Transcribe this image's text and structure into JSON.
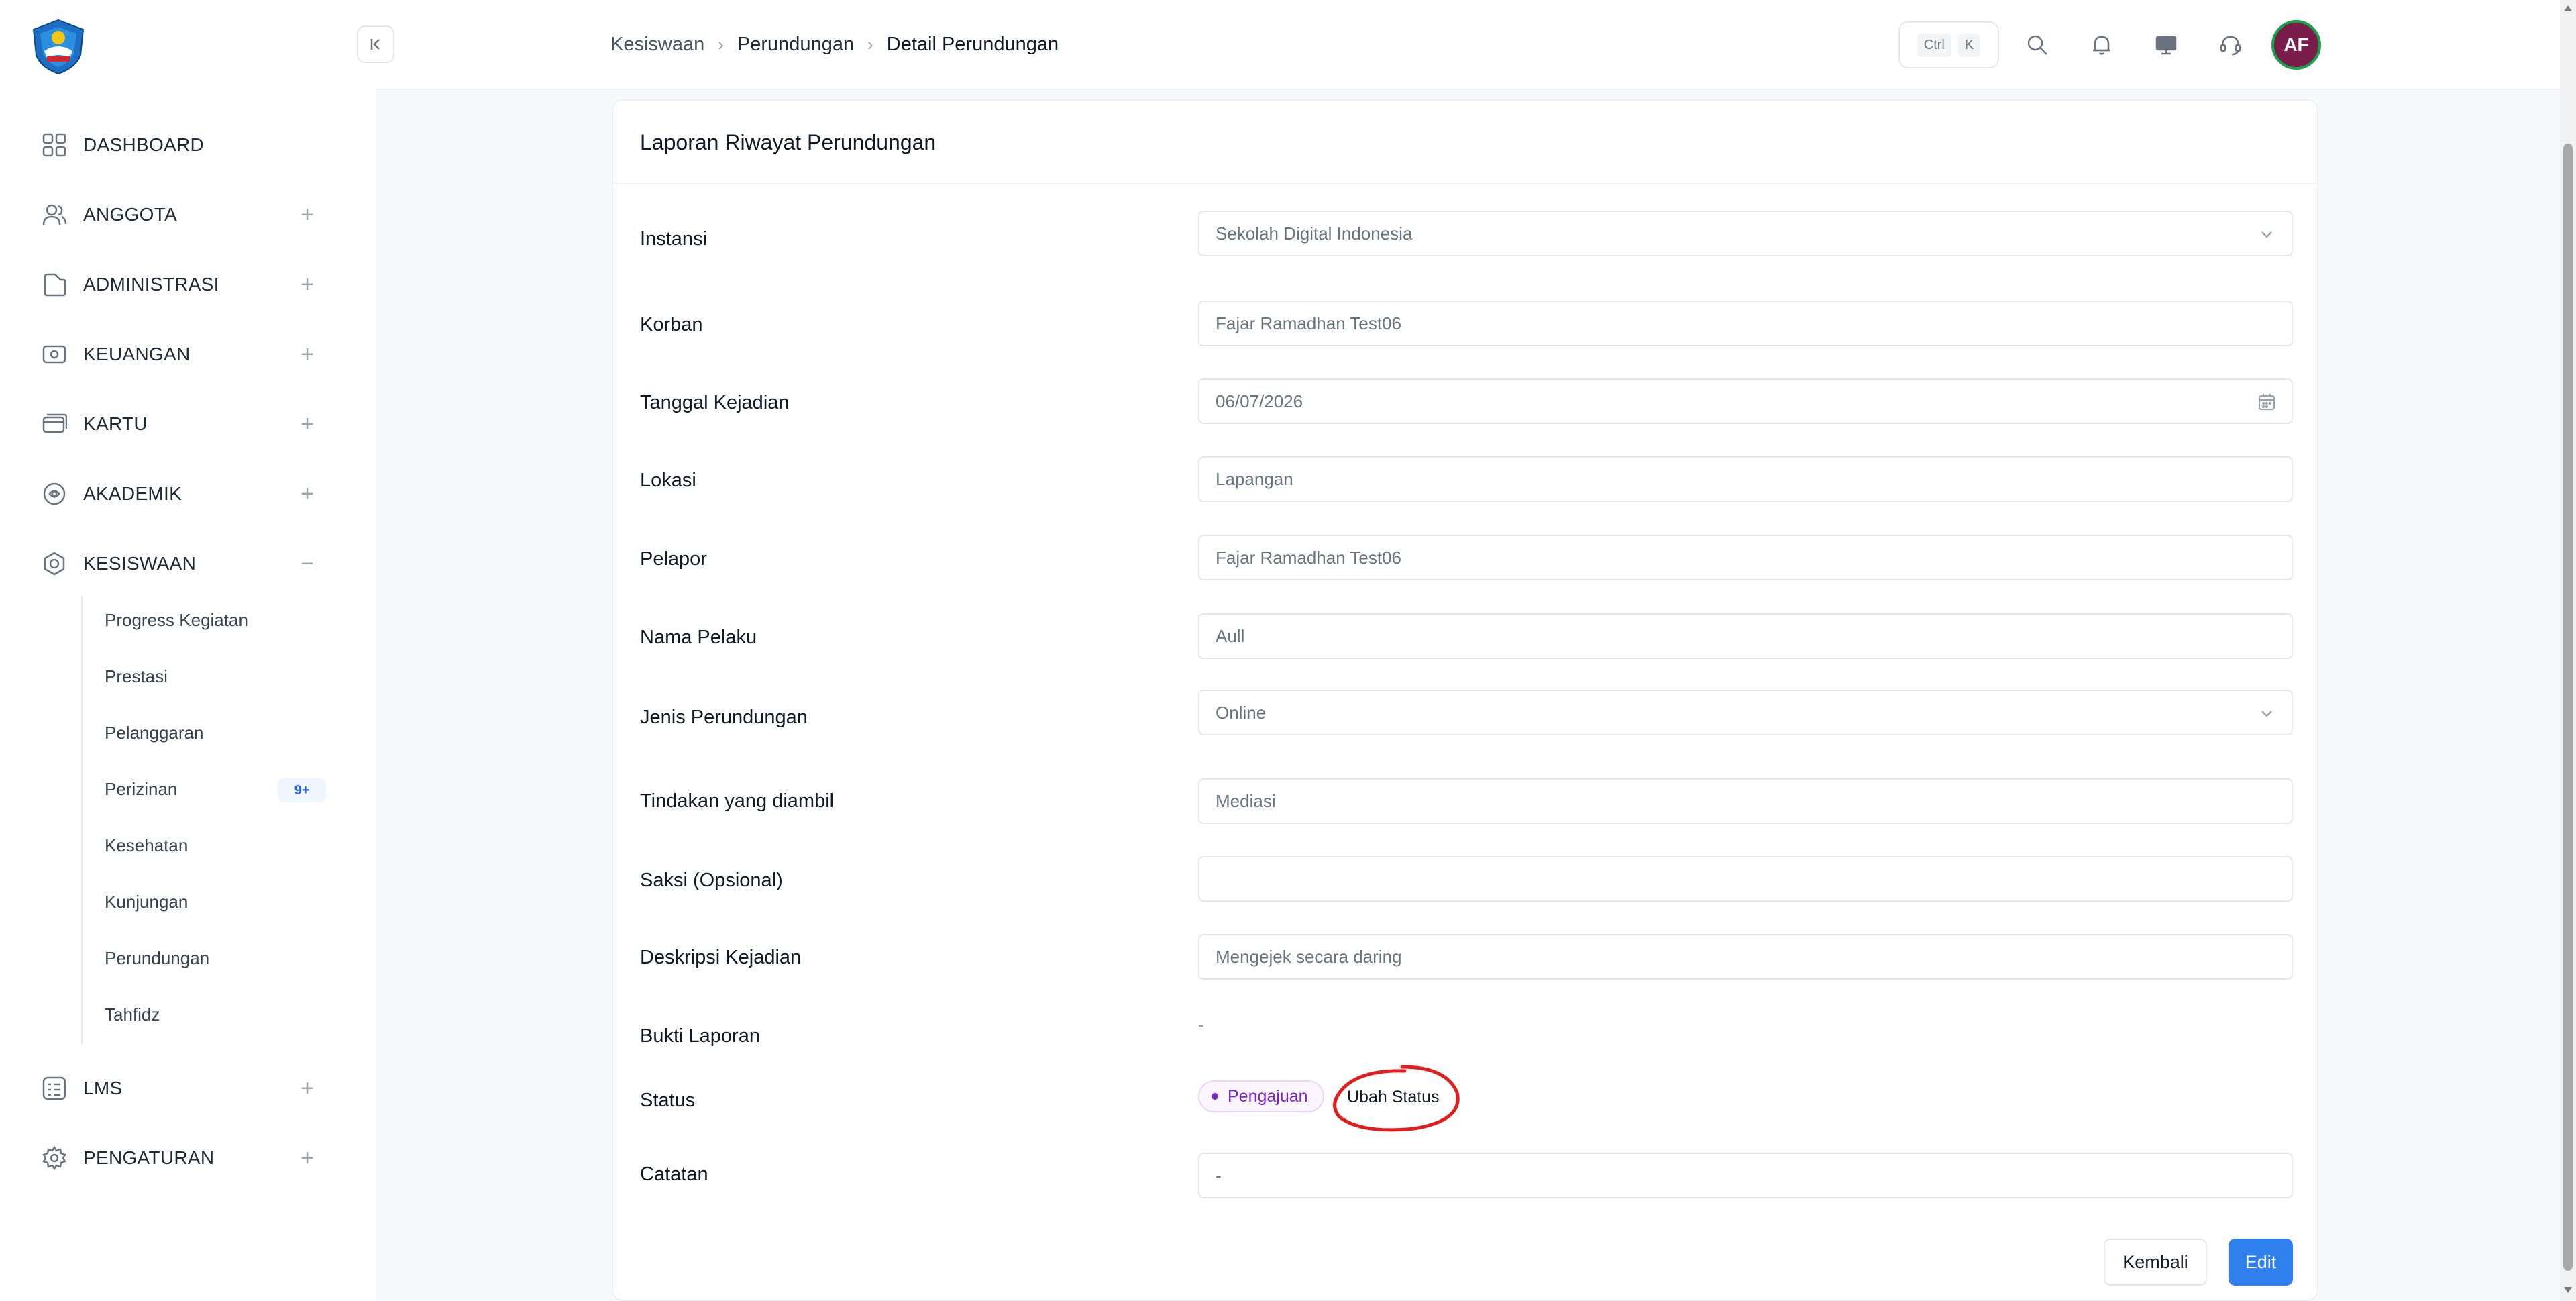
{
  "sidebar": {
    "menu": [
      {
        "label": "DASHBOARD",
        "icon": "dashboard-icon"
      },
      {
        "label": "ANGGOTA",
        "icon": "users-icon",
        "toggle": "+"
      },
      {
        "label": "ADMINISTRASI",
        "icon": "folder-icon",
        "toggle": "+"
      },
      {
        "label": "KEUANGAN",
        "icon": "finance-icon",
        "toggle": "+"
      },
      {
        "label": "KARTU",
        "icon": "card-icon",
        "toggle": "+"
      },
      {
        "label": "AKADEMIK",
        "icon": "academic-icon",
        "toggle": "+"
      },
      {
        "label": "KESISWAAN",
        "icon": "student-affairs-icon",
        "toggle": "−"
      },
      {
        "label": "LMS",
        "icon": "lms-icon",
        "toggle": "+"
      },
      {
        "label": "PENGATURAN",
        "icon": "settings-icon",
        "toggle": "+"
      }
    ],
    "submenu": [
      {
        "label": "Progress Kegiatan"
      },
      {
        "label": "Prestasi"
      },
      {
        "label": "Pelanggaran"
      },
      {
        "label": "Perizinan",
        "badge": "9+"
      },
      {
        "label": "Kesehatan"
      },
      {
        "label": "Kunjungan"
      },
      {
        "label": "Perundungan"
      },
      {
        "label": "Tahfidz"
      }
    ]
  },
  "header": {
    "breadcrumb": [
      "Kesiswaan",
      "Perundungan",
      "Detail Perundungan"
    ],
    "shortcut": {
      "ctrl": "Ctrl",
      "key": "K"
    },
    "avatar_initials": "AF"
  },
  "card": {
    "title": "Laporan Riwayat Perundungan",
    "fields": [
      {
        "label": "Instansi",
        "value": "Sekolah Digital Indonesia",
        "kind": "select"
      },
      {
        "label": "Korban",
        "value": "Fajar Ramadhan Test06",
        "kind": "text"
      },
      {
        "label": "Tanggal Kejadian",
        "value": "06/07/2026",
        "kind": "date"
      },
      {
        "label": "Lokasi",
        "value": "Lapangan",
        "kind": "text"
      },
      {
        "label": "Pelapor",
        "value": "Fajar Ramadhan Test06",
        "kind": "text"
      },
      {
        "label": "Nama Pelaku",
        "value": "Aull",
        "kind": "text"
      },
      {
        "label": "Jenis Perundungan",
        "value": "Online",
        "kind": "select"
      },
      {
        "label": "Tindakan yang diambil",
        "value": "Mediasi",
        "kind": "text"
      },
      {
        "label": "Saksi (Opsional)",
        "value": "",
        "kind": "text"
      },
      {
        "label": "Deskripsi Kejadian",
        "value": "Mengejek secara daring",
        "kind": "text"
      }
    ],
    "bukti_label": "Bukti Laporan",
    "bukti_value": "-",
    "status_label": "Status",
    "status_value": "Pengajuan",
    "ubah_status": "Ubah Status",
    "catatan_label": "Catatan",
    "catatan_value": "-",
    "btn_back": "Kembali",
    "btn_edit": "Edit"
  },
  "colors": {
    "primary": "#2f80ed",
    "status_purple": "#7e22ce",
    "annotation_red": "#e11d1d",
    "avatar_bg": "#7b1d4a"
  }
}
